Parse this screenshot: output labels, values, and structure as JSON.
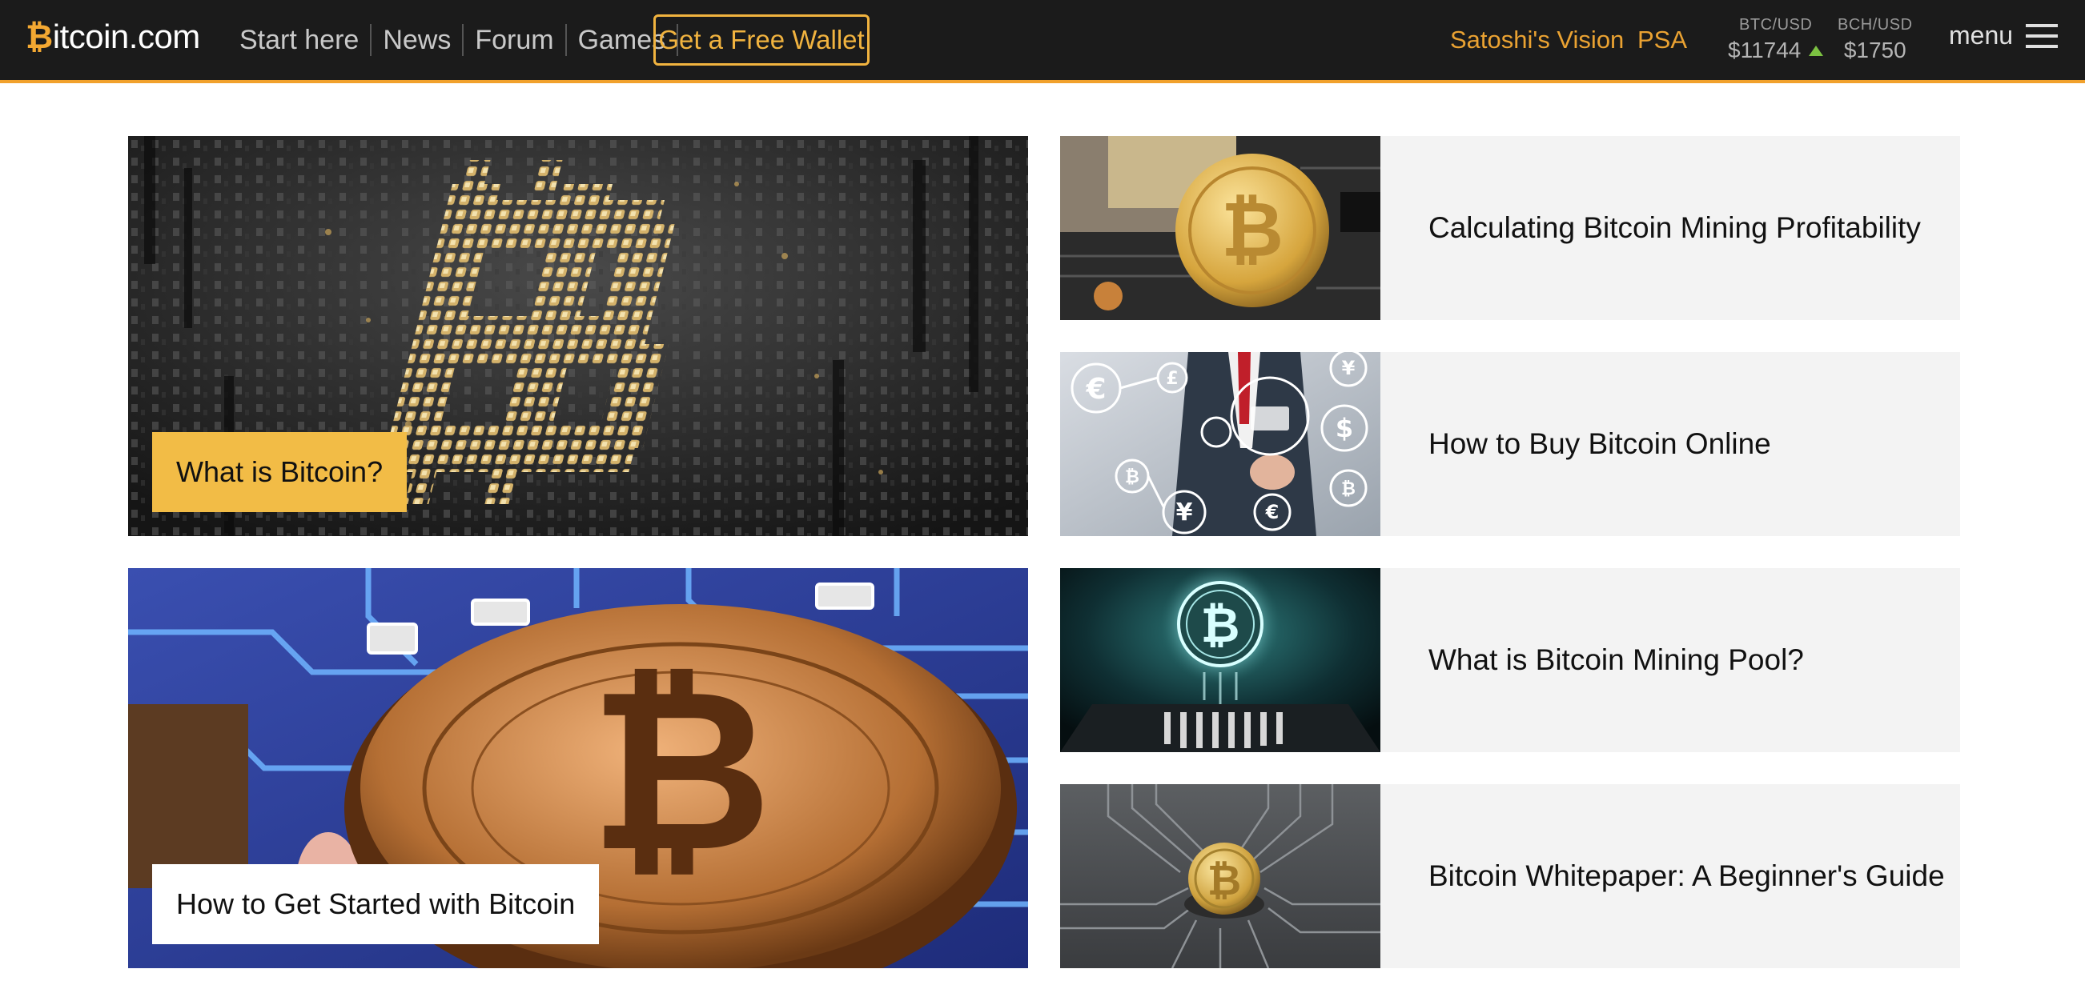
{
  "header": {
    "logo_letter": "₿",
    "logo_rest": "itcoin.com",
    "nav": [
      {
        "label": "Start here"
      },
      {
        "label": "News"
      },
      {
        "label": "Forum"
      },
      {
        "label": "Games"
      }
    ],
    "wallet_button": "Get a Free Wallet",
    "links": {
      "satoshi": "Satoshi's Vision",
      "psa": "PSA"
    },
    "tickers": [
      {
        "pair": "BTC/USD",
        "price": "$11744",
        "trend": "up"
      },
      {
        "pair": "BCH/USD",
        "price": "$1750"
      }
    ],
    "menu_label": "menu"
  },
  "featured": [
    {
      "label": "What is Bitcoin?",
      "label_bg": "#f2bc46",
      "image_icon": "circuit-bitcoin-symbol-image"
    },
    {
      "label": "How to Get Started with Bitcoin",
      "label_bg": "#ffffff",
      "image_icon": "gold-bitcoin-coin-on-circuit-image"
    }
  ],
  "articles": [
    {
      "title": "Calculating Bitcoin Mining Profitability",
      "image_icon": "coin-on-motherboard-image"
    },
    {
      "title": "How to Buy Bitcoin Online",
      "image_icon": "businessman-currency-icons-image"
    },
    {
      "title": "What is Bitcoin Mining Pool?",
      "image_icon": "glowing-coin-on-chip-image"
    },
    {
      "title": "Bitcoin Whitepaper: A Beginner's Guide",
      "image_icon": "coin-on-grey-circuit-image"
    }
  ],
  "colors": {
    "accent": "#f1a12c",
    "header_bg": "#1b1b1b",
    "card_bg": "#f3f3f3",
    "trend_up": "#7cc242"
  }
}
